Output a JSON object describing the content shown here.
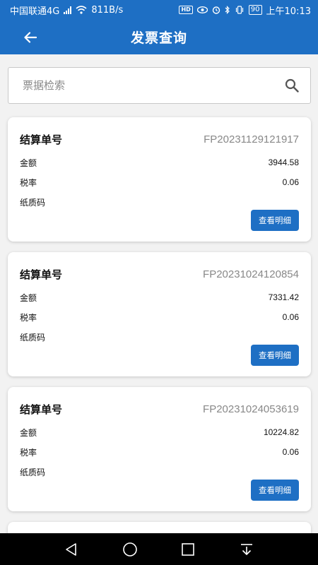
{
  "status_bar": {
    "carrier": "中国联通4G",
    "net_badge": "4G",
    "speed": "811B/s",
    "hd": "HD",
    "battery": "90",
    "time": "上午10:13"
  },
  "app_bar": {
    "title": "发票查询"
  },
  "search": {
    "placeholder": "票据检索",
    "value": ""
  },
  "invoices": [
    {
      "number_label": "结算单号",
      "number": "FP20231129121917",
      "amount_label": "金额",
      "amount": "3944.58",
      "tax_label": "税率",
      "tax": "0.06",
      "paper_label": "纸质码",
      "paper": "",
      "button": "查看明细"
    },
    {
      "number_label": "结算单号",
      "number": "FP20231024120854",
      "amount_label": "金额",
      "amount": "7331.42",
      "tax_label": "税率",
      "tax": "0.06",
      "paper_label": "纸质码",
      "paper": "",
      "button": "查看明细"
    },
    {
      "number_label": "结算单号",
      "number": "FP20231024053619",
      "amount_label": "金额",
      "amount": "10224.82",
      "tax_label": "税率",
      "tax": "0.06",
      "paper_label": "纸质码",
      "paper": "",
      "button": "查看明细"
    }
  ],
  "colors": {
    "primary": "#1e6fc4",
    "background": "#f2f2f2"
  },
  "icons": [
    "back-arrow-icon",
    "search-icon",
    "nav-back-icon",
    "nav-home-icon",
    "nav-recents-icon",
    "nav-notification-icon"
  ]
}
